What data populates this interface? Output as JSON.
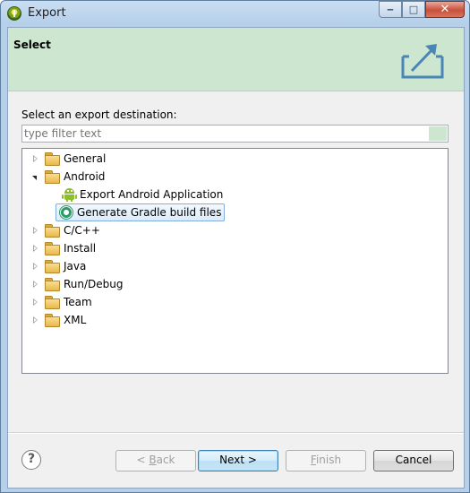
{
  "window": {
    "title": "Export"
  },
  "banner": {
    "title": "Select"
  },
  "prompt": "Select an export destination:",
  "filter": {
    "placeholder": "type filter text",
    "value": ""
  },
  "tree": {
    "items": [
      {
        "label": "General",
        "expanded": false,
        "icon": "folder-icon"
      },
      {
        "label": "Android",
        "expanded": true,
        "icon": "folder-icon"
      },
      {
        "label": "Export Android Application",
        "icon": "android-icon",
        "child": true
      },
      {
        "label": "Generate Gradle build files",
        "icon": "gradle-icon",
        "child": true,
        "selected": true
      },
      {
        "label": "C/C++",
        "expanded": false,
        "icon": "folder-icon"
      },
      {
        "label": "Install",
        "expanded": false,
        "icon": "folder-icon"
      },
      {
        "label": "Java",
        "expanded": false,
        "icon": "folder-icon"
      },
      {
        "label": "Run/Debug",
        "expanded": false,
        "icon": "folder-icon"
      },
      {
        "label": "Team",
        "expanded": false,
        "icon": "folder-icon"
      },
      {
        "label": "XML",
        "expanded": false,
        "icon": "folder-icon"
      }
    ]
  },
  "buttons": {
    "help": "?",
    "back": {
      "prefix": "< ",
      "mnemonic": "B",
      "rest": "ack",
      "enabled": false
    },
    "next": {
      "label": "Next >",
      "enabled": true,
      "default": true
    },
    "finish": {
      "mnemonic": "F",
      "rest": "inish",
      "enabled": false
    },
    "cancel": {
      "label": "Cancel",
      "enabled": true
    }
  },
  "colors": {
    "banner": "#cde6cf",
    "selection": "#dcecfc",
    "window_frame": "#b7d0ea"
  }
}
